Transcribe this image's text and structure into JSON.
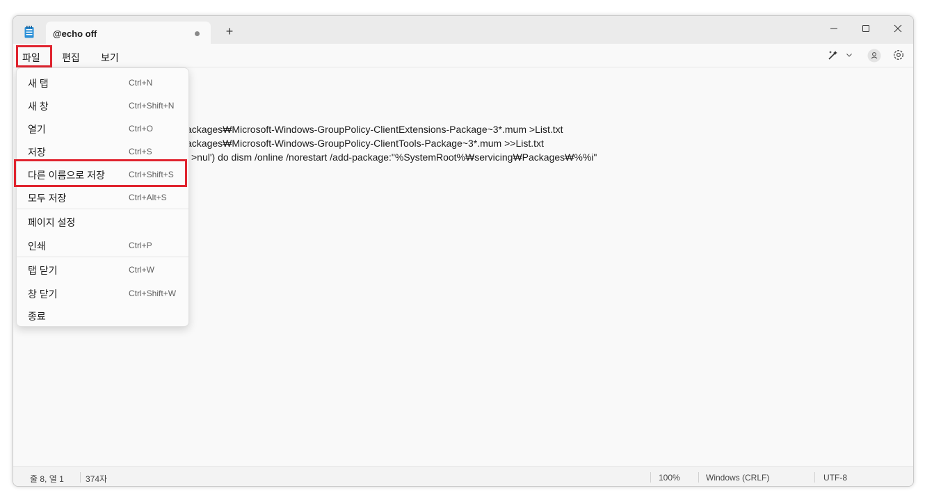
{
  "tab": {
    "title": "@echo off"
  },
  "new_tab_label": "+",
  "menu": {
    "file": "파일",
    "edit": "편집",
    "view": "보기"
  },
  "editor_lines": [
    "ackages₩Microsoft-Windows-GroupPolicy-ClientExtensions-Package~3*.mum >List.txt",
    "ackages₩Microsoft-Windows-GroupPolicy-ClientTools-Package~3*.mum >>List.txt",
    ">nul') do dism /online /norestart /add-package:\"%SystemRoot%₩servicing₩Packages₩%%i\""
  ],
  "file_menu": {
    "items": [
      {
        "label": "새 탭",
        "shortcut": "Ctrl+N"
      },
      {
        "label": "새 창",
        "shortcut": "Ctrl+Shift+N"
      },
      {
        "label": "열기",
        "shortcut": "Ctrl+O"
      },
      {
        "label": "저장",
        "shortcut": "Ctrl+S"
      },
      {
        "label": "다른 이름으로 저장",
        "shortcut": "Ctrl+Shift+S"
      },
      {
        "label": "모두 저장",
        "shortcut": "Ctrl+Alt+S"
      },
      {
        "label": "페이지 설정",
        "shortcut": ""
      },
      {
        "label": "인쇄",
        "shortcut": "Ctrl+P"
      },
      {
        "label": "탭 닫기",
        "shortcut": "Ctrl+W"
      },
      {
        "label": "창 닫기",
        "shortcut": "Ctrl+Shift+W"
      },
      {
        "label": "종료",
        "shortcut": ""
      }
    ]
  },
  "status": {
    "position": "줄 8, 열 1",
    "chars": "374자",
    "zoom": "100%",
    "line_ending": "Windows (CRLF)",
    "encoding": "UTF-8"
  },
  "colors": {
    "highlight": "#e0242f",
    "accent": "#0f6cbd"
  }
}
